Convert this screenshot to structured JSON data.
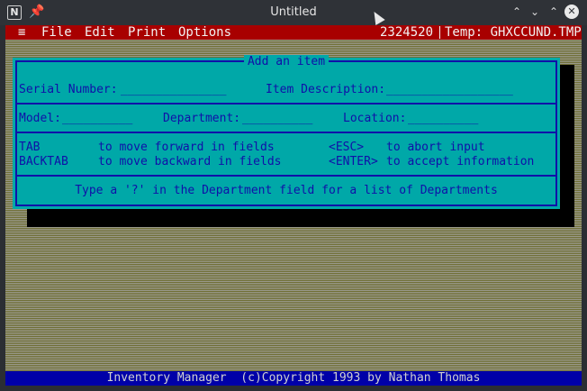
{
  "window": {
    "title": "Untitled",
    "app_icon": "N",
    "buttons": [
      "minimize-up-icon",
      "minimize-down-icon",
      "close-icon"
    ]
  },
  "menubar": {
    "system_icon": "≡",
    "items": [
      "File",
      "Edit",
      "Print",
      "Options"
    ],
    "record": "2324520",
    "temp_label": "Temp: GHXCCUND.TMP"
  },
  "dialog": {
    "title": "Add an item",
    "fields": {
      "serial_label": "Serial Number:",
      "serial_value": "_______________",
      "description_label": "Item Description:",
      "description_value": "__________________",
      "model_label": "Model:",
      "model_value": "__________",
      "department_label": "Department:",
      "department_value": "__________",
      "location_label": "Location:",
      "location_value": "__________"
    },
    "help": {
      "tab_key": "TAB",
      "tab_text": "to move forward in fields",
      "esc_key": "<ESC>",
      "esc_text": "to abort input",
      "backtab_key": "BACKTAB",
      "backtab_text": "to move backward in fields",
      "enter_key": "<ENTER>",
      "enter_text": "to accept information"
    },
    "hint": "Type a '?' in the Department field for a list of Departments"
  },
  "statusbar": {
    "text": "Inventory Manager  (c)Copyright 1993 by Nathan Thomas"
  },
  "colors": {
    "menubar": "#a80000",
    "dialog": "#00a8a8",
    "dialog_text": "#1010a8",
    "statusbar": "#0000a8"
  }
}
